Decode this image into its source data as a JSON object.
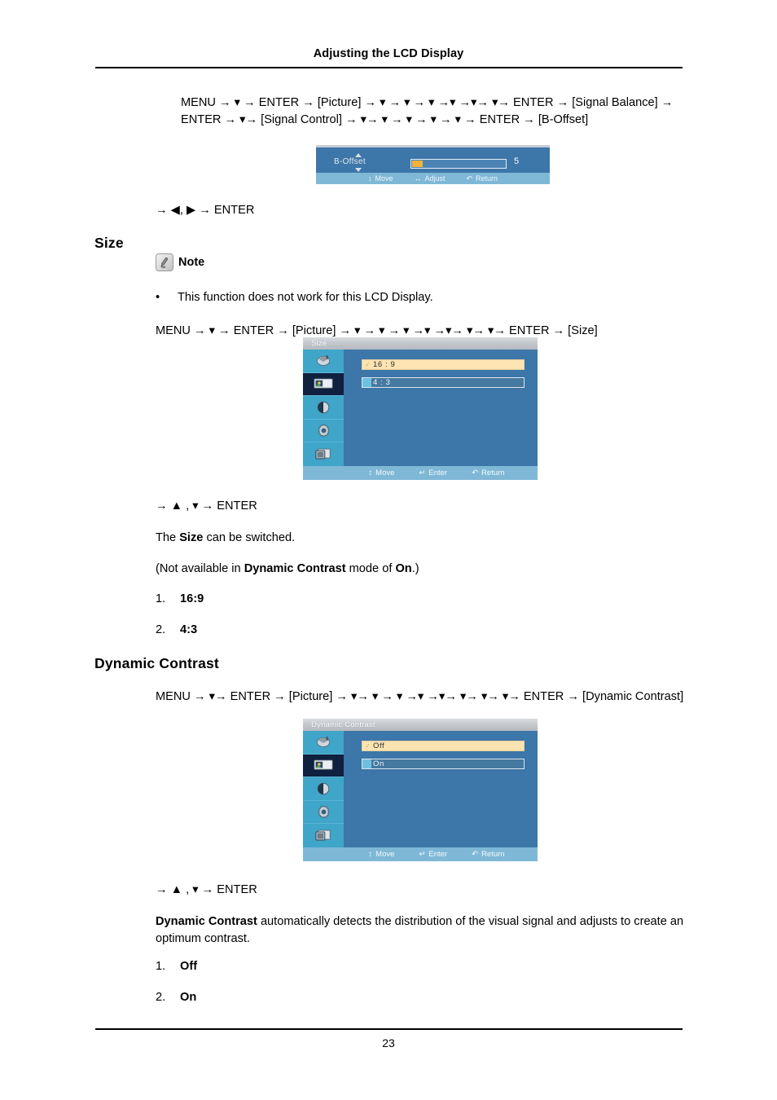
{
  "document": {
    "header_title": "Adjusting the LCD Display",
    "page_number": "23"
  },
  "sections": {
    "b_offset": {
      "nav_line_1": "MENU → ▾ → ENTER → [Picture] → ▾ → ▾ → ▾ →▾ →▾→ ▾→ ENTER → [Signal Balance] → ENTER → ▾→ [Signal Control] → ▾→ ▾ → ▾ → ▾ → ▾ → ENTER → [B-Offset]",
      "after_nav": "→ ◀, ▶ → ENTER",
      "osd": {
        "label": "B-Offset",
        "value": "5",
        "status": [
          "Move",
          "Adjust",
          "Return"
        ]
      }
    },
    "size": {
      "heading": "Size",
      "note_label": "Note",
      "note_bullet": "This function does not work for this LCD Display.",
      "nav_line": "MENU → ▾ → ENTER → [Picture] → ▾ → ▾ → ▾ →▾ →▾→ ▾→ ▾→ ENTER → [Size]",
      "after_nav": "→ ▲ , ▾ → ENTER",
      "desc_1_pre": "The ",
      "desc_1_bold": "Size",
      "desc_1_post": " can be switched.",
      "desc_2_pre": "(Not available in ",
      "desc_2_bold": "Dynamic Contrast",
      "desc_2_mid": " mode of ",
      "desc_2_bold2": "On",
      "desc_2_post": ".)",
      "items": [
        {
          "num": "1.",
          "label": "16:9"
        },
        {
          "num": "2.",
          "label": "4:3"
        }
      ],
      "osd": {
        "title": "Size",
        "options": [
          {
            "label": "16 : 9",
            "selected": true
          },
          {
            "label": "4 : 3",
            "selected": false
          }
        ],
        "status": [
          "Move",
          "Enter",
          "Return"
        ],
        "sidebar_icons": [
          "input-icon",
          "picture-icon",
          "sound-icon",
          "setup-icon",
          "multi-control-icon"
        ],
        "active_sidebar_index": 1
      }
    },
    "dynamic_contrast": {
      "heading": "Dynamic Contrast",
      "nav_line": "MENU → ▾→ ENTER → [Picture] → ▾→ ▾ → ▾ →▾ →▾→ ▾→ ▾→ ▾→ ENTER → [Dynamic Contrast]",
      "after_nav": "→ ▲ , ▾ → ENTER",
      "desc_bold": "Dynamic Contrast",
      "desc_rest": " automatically detects the distribution of the visual signal and adjusts to create an optimum contrast.",
      "items": [
        {
          "num": "1.",
          "label": "Off"
        },
        {
          "num": "2.",
          "label": "On"
        }
      ],
      "osd": {
        "title": "Dynamic Contrast",
        "options": [
          {
            "label": "Off",
            "selected": true
          },
          {
            "label": "On",
            "selected": false
          }
        ],
        "status": [
          "Move",
          "Enter",
          "Return"
        ],
        "sidebar_icons": [
          "input-icon",
          "picture-icon",
          "sound-icon",
          "setup-icon",
          "multi-control-icon"
        ],
        "active_sidebar_index": 1
      }
    }
  },
  "colors": {
    "osd_background": "#3d76a8",
    "osd_selected_row": "#fbe3b2",
    "osd_statusbar": "#7fb8d6",
    "osd_sidebar": "#3fa5c9",
    "osd_sidebar_active": "#10203f",
    "slider_fill": "#f2b23a"
  }
}
